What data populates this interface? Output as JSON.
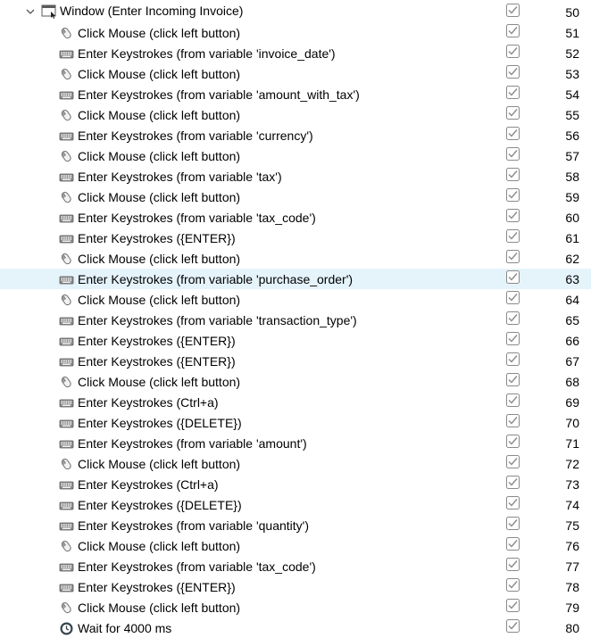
{
  "tree": {
    "parent": {
      "label": "Window (Enter Incoming Invoice)",
      "number": "50",
      "icon": "window-icon",
      "checked": true
    },
    "rows": [
      {
        "type": "click",
        "icon": "mouse-icon",
        "label": "Click Mouse (click left button)",
        "number": "51",
        "checked": true
      },
      {
        "type": "keys",
        "icon": "keyboard-icon",
        "label": "Enter Keystrokes (from variable 'invoice_date')",
        "number": "52",
        "checked": true
      },
      {
        "type": "click",
        "icon": "mouse-icon",
        "label": "Click Mouse (click left button)",
        "number": "53",
        "checked": true
      },
      {
        "type": "keys",
        "icon": "keyboard-icon",
        "label": "Enter Keystrokes (from variable 'amount_with_tax')",
        "number": "54",
        "checked": true
      },
      {
        "type": "click",
        "icon": "mouse-icon",
        "label": "Click Mouse (click left button)",
        "number": "55",
        "checked": true
      },
      {
        "type": "keys",
        "icon": "keyboard-icon",
        "label": "Enter Keystrokes (from variable 'currency')",
        "number": "56",
        "checked": true
      },
      {
        "type": "click",
        "icon": "mouse-icon",
        "label": "Click Mouse (click left button)",
        "number": "57",
        "checked": true
      },
      {
        "type": "keys",
        "icon": "keyboard-icon",
        "label": "Enter Keystrokes (from variable 'tax')",
        "number": "58",
        "checked": true
      },
      {
        "type": "click",
        "icon": "mouse-icon",
        "label": "Click Mouse (click left button)",
        "number": "59",
        "checked": true
      },
      {
        "type": "keys",
        "icon": "keyboard-icon",
        "label": "Enter Keystrokes (from variable 'tax_code')",
        "number": "60",
        "checked": true
      },
      {
        "type": "keys",
        "icon": "keyboard-icon",
        "label": "Enter Keystrokes ({ENTER})",
        "number": "61",
        "checked": true
      },
      {
        "type": "click",
        "icon": "mouse-icon",
        "label": "Click Mouse (click left button)",
        "number": "62",
        "checked": true
      },
      {
        "type": "keys",
        "icon": "keyboard-icon",
        "label": "Enter Keystrokes (from variable 'purchase_order')",
        "number": "63",
        "checked": true,
        "selected": true
      },
      {
        "type": "click",
        "icon": "mouse-icon",
        "label": "Click Mouse (click left button)",
        "number": "64",
        "checked": true
      },
      {
        "type": "keys",
        "icon": "keyboard-icon",
        "label": "Enter Keystrokes (from variable 'transaction_type')",
        "number": "65",
        "checked": true
      },
      {
        "type": "keys",
        "icon": "keyboard-icon",
        "label": "Enter Keystrokes ({ENTER})",
        "number": "66",
        "checked": true
      },
      {
        "type": "keys",
        "icon": "keyboard-icon",
        "label": "Enter Keystrokes ({ENTER})",
        "number": "67",
        "checked": true
      },
      {
        "type": "click",
        "icon": "mouse-icon",
        "label": "Click Mouse (click left button)",
        "number": "68",
        "checked": true
      },
      {
        "type": "keys",
        "icon": "keyboard-icon",
        "label": "Enter Keystrokes (Ctrl+a)",
        "number": "69",
        "checked": true
      },
      {
        "type": "keys",
        "icon": "keyboard-icon",
        "label": "Enter Keystrokes ({DELETE})",
        "number": "70",
        "checked": true
      },
      {
        "type": "keys",
        "icon": "keyboard-icon",
        "label": "Enter Keystrokes (from variable 'amount')",
        "number": "71",
        "checked": true
      },
      {
        "type": "click",
        "icon": "mouse-icon",
        "label": "Click Mouse (click left button)",
        "number": "72",
        "checked": true
      },
      {
        "type": "keys",
        "icon": "keyboard-icon",
        "label": "Enter Keystrokes (Ctrl+a)",
        "number": "73",
        "checked": true
      },
      {
        "type": "keys",
        "icon": "keyboard-icon",
        "label": "Enter Keystrokes ({DELETE})",
        "number": "74",
        "checked": true
      },
      {
        "type": "keys",
        "icon": "keyboard-icon",
        "label": "Enter Keystrokes (from variable 'quantity')",
        "number": "75",
        "checked": true
      },
      {
        "type": "click",
        "icon": "mouse-icon",
        "label": "Click Mouse (click left button)",
        "number": "76",
        "checked": true
      },
      {
        "type": "keys",
        "icon": "keyboard-icon",
        "label": "Enter Keystrokes (from variable 'tax_code')",
        "number": "77",
        "checked": true
      },
      {
        "type": "keys",
        "icon": "keyboard-icon",
        "label": "Enter Keystrokes ({ENTER})",
        "number": "78",
        "checked": true
      },
      {
        "type": "click",
        "icon": "mouse-icon",
        "label": "Click Mouse (click left button)",
        "number": "79",
        "checked": true
      },
      {
        "type": "wait",
        "icon": "clock-icon",
        "label": "Wait for 4000 ms",
        "number": "80",
        "checked": true
      }
    ]
  },
  "colors": {
    "selected_bg": "#e5f3fb",
    "check_border": "#8a8a8a",
    "check_mark": "#8a8a8a",
    "wait_icon": "#37474f"
  }
}
